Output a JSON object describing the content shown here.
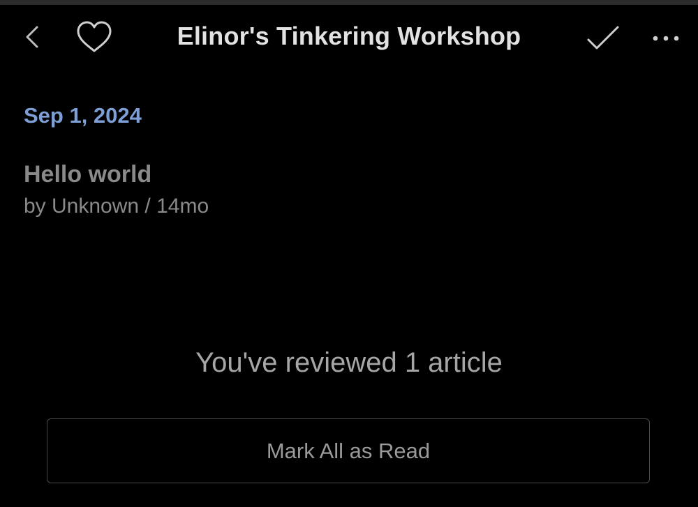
{
  "header": {
    "title": "Elinor's Tinkering Workshop",
    "icons": {
      "back": "chevron-left-icon",
      "favorite": "heart-outline-icon",
      "mark_read": "checkmark-icon",
      "more": "more-horizontal-icon"
    }
  },
  "feed": {
    "date_header": "Sep 1, 2024",
    "articles": [
      {
        "title": "Hello world",
        "meta": "by Unknown / 14mo"
      }
    ]
  },
  "footer": {
    "review_message": "You've reviewed 1 article",
    "mark_all_label": "Mark All as Read"
  },
  "colors": {
    "background": "#000000",
    "date_accent": "#7e9fd6",
    "title_text": "#e2e2e2",
    "muted_text": "#8a8a8a",
    "button_border": "#4a4a4a"
  }
}
